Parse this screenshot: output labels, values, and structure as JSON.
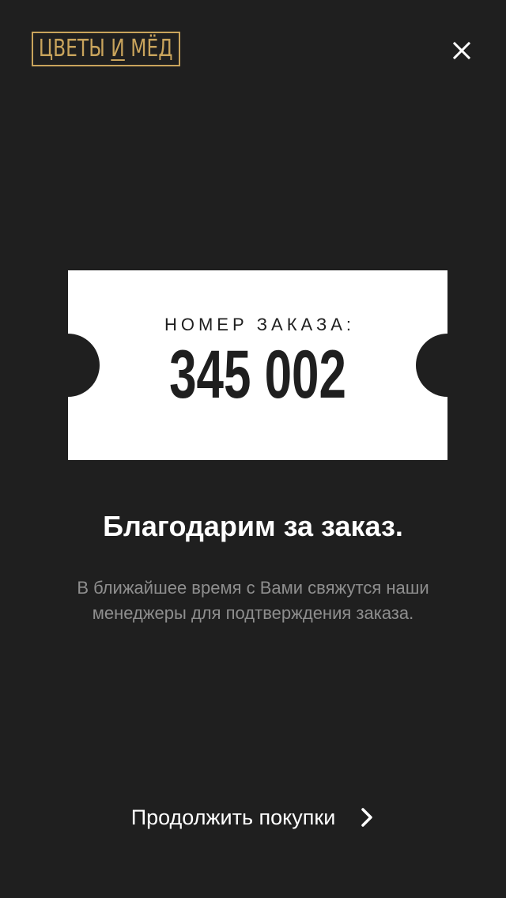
{
  "brand": {
    "logo_text_before": "ЦВЕТЫ ",
    "logo_text_mid": "И",
    "logo_text_after": " МЁД",
    "accent_color": "#c9a45c"
  },
  "header": {
    "close_icon": "close-icon"
  },
  "ticket": {
    "label": "НОМЕР ЗАКАЗА:",
    "order_number": "345 002"
  },
  "message": {
    "title": "Благодарим за заказ.",
    "body": "В ближайшее время с Вами свяжутся наши менеджеры для подтверждения заказа."
  },
  "actions": {
    "continue_label": "Продолжить покупки",
    "continue_icon": "chevron-right-icon"
  },
  "colors": {
    "background": "#1f1f1f",
    "text_primary": "#ffffff",
    "text_secondary": "#8e8e8e"
  }
}
